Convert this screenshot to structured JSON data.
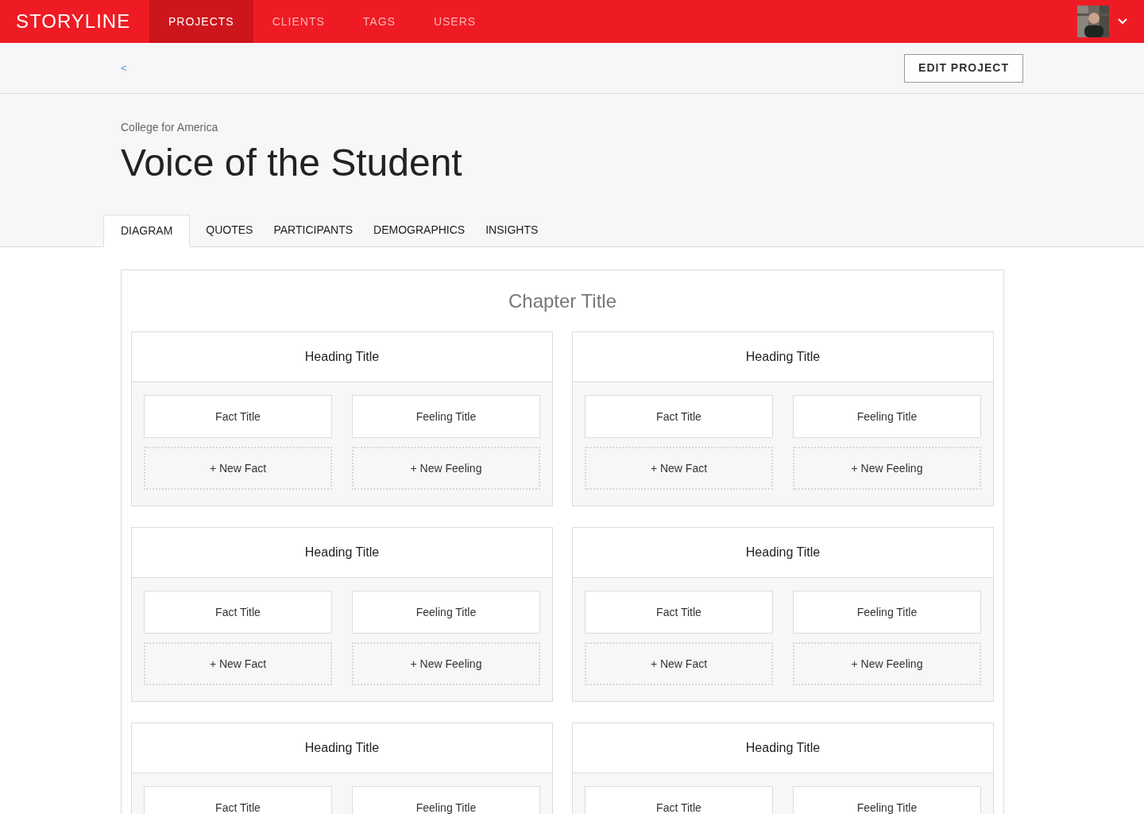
{
  "brand": "STORYLINE",
  "nav": [
    {
      "label": "PROJECTS",
      "selected": true
    },
    {
      "label": "CLIENTS",
      "selected": false
    },
    {
      "label": "TAGS",
      "selected": false
    },
    {
      "label": "USERS",
      "selected": false
    }
  ],
  "back_link": "<",
  "edit_button": "EDIT PROJECT",
  "client": "College for America",
  "title": "Voice of the Student",
  "tabs": [
    {
      "label": "DIAGRAM",
      "selected": true
    },
    {
      "label": "QUOTES",
      "selected": false
    },
    {
      "label": "PARTICIPANTS",
      "selected": false
    },
    {
      "label": "DEMOGRAPHICS",
      "selected": false
    },
    {
      "label": "INSIGHTS",
      "selected": false
    }
  ],
  "chapter": {
    "title": "Chapter Title",
    "sections": [
      {
        "heading": "Heading Title",
        "fact": "Fact Title",
        "feeling": "Feeling Title",
        "new_fact": "+ New Fact",
        "new_feeling": "+ New Feeling"
      },
      {
        "heading": "Heading Title",
        "fact": "Fact Title",
        "feeling": "Feeling Title",
        "new_fact": "+ New Fact",
        "new_feeling": "+ New Feeling"
      },
      {
        "heading": "Heading Title",
        "fact": "Fact Title",
        "feeling": "Feeling Title",
        "new_fact": "+ New Fact",
        "new_feeling": "+ New Feeling"
      },
      {
        "heading": "Heading Title",
        "fact": "Fact Title",
        "feeling": "Feeling Title",
        "new_fact": "+ New Fact",
        "new_feeling": "+ New Feeling"
      },
      {
        "heading": "Heading Title",
        "fact": "Fact Title",
        "feeling": "Feeling Title"
      },
      {
        "heading": "Heading Title",
        "fact": "Fact Title",
        "feeling": "Feeling Title"
      }
    ]
  }
}
